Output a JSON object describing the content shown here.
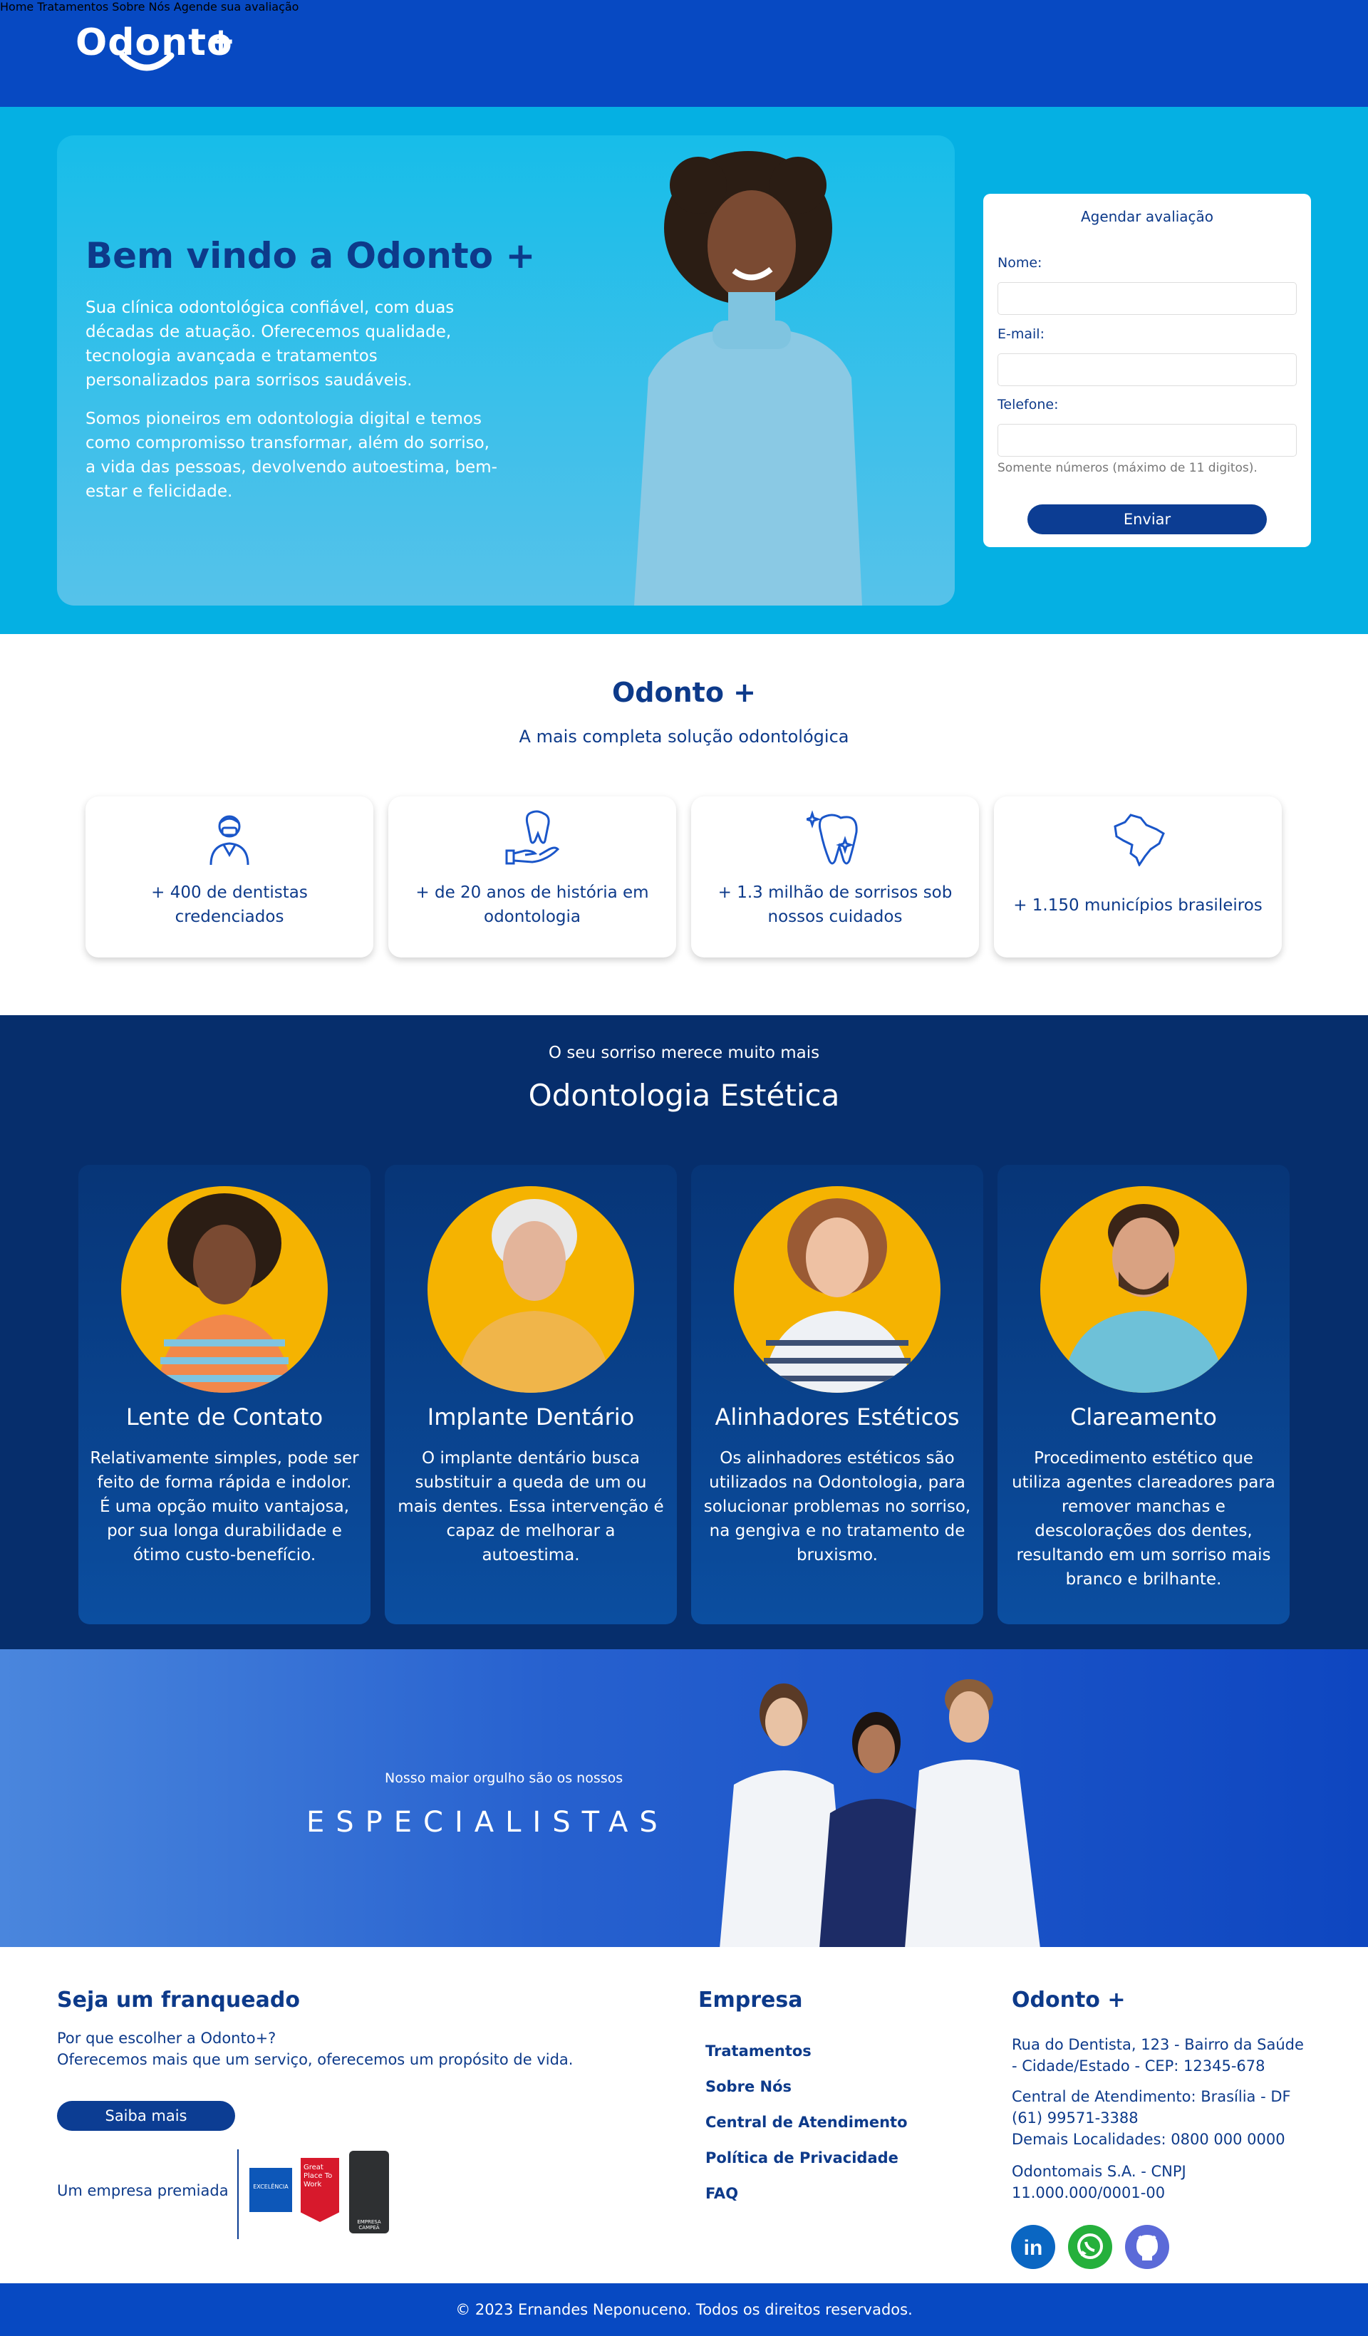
{
  "header": {
    "logo_text": "Odonto",
    "logo_plus": "+",
    "nav": [
      "Home",
      "Tratamentos",
      "Sobre Nós",
      "Agende sua avaliação"
    ]
  },
  "hero": {
    "title": "Bem vindo a Odonto +",
    "p1": "Sua clínica odontológica confiável, com duas décadas de atuação. Oferecemos qualidade, tecnologia avançada e tratamentos personalizados para sorrisos saudáveis.",
    "p2": "Somos pioneiros em odontologia digital e temos como compromisso transformar, além do sorriso, a vida das pessoas, devolvendo autoestima, bem-estar e felicidade."
  },
  "form": {
    "title": "Agendar avaliação",
    "name_label": "Nome:",
    "email_label": "E-mail:",
    "phone_label": "Telefone:",
    "phone_hint": "Somente números (máximo de 11 digitos).",
    "submit": "Enviar"
  },
  "about": {
    "title": "Odonto +",
    "subtitle": "A mais completa solução odontológica",
    "stats": [
      {
        "icon": "dentist-icon",
        "text": "+ 400 de dentistas credenciados"
      },
      {
        "icon": "tooth-hand-icon",
        "text": "+ de 20 anos de história em odontologia"
      },
      {
        "icon": "sparkling-tooth-icon",
        "text": "+ 1.3 milhão de sorrisos sob nossos cuidados"
      },
      {
        "icon": "brazil-map-icon",
        "text": "+ 1.150 municípios brasileiros"
      }
    ]
  },
  "esthetics": {
    "pretitle": "O seu sorriso merece muito mais",
    "title": "Odontologia Estética",
    "treatments": [
      {
        "title": "Lente de Contato",
        "text": "Relativamente simples, pode ser feito de forma rápida e indolor. É uma opção muito vantajosa, por sua longa durabilidade e ótimo custo-benefício."
      },
      {
        "title": "Implante Dentário",
        "text": "O implante dentário busca substituir a queda de um ou mais dentes. Essa intervenção é capaz de melhorar a autoestima."
      },
      {
        "title": "Alinhadores Estéticos",
        "text": "Os alinhadores estéticos são utilizados na Odontologia, para solucionar problemas no sorriso, na gengiva e no tratamento de bruxismo."
      },
      {
        "title": "Clareamento",
        "text": "Procedimento estético que utiliza agentes clareadores para remover manchas e descolorações dos dentes, resultando em um sorriso mais branco e brilhante."
      }
    ]
  },
  "specialists": {
    "pretitle": "Nosso maior orgulho são os nossos",
    "title": "ESPECIALISTAS"
  },
  "footer": {
    "franchise_title": "Seja um franqueado",
    "franchise_q": "Por que escolher a Odonto+?",
    "franchise_text": "Oferecemos mais que um serviço, oferecemos um propósito de vida.",
    "franchise_button": "Saiba mais",
    "award_label": "Um empresa premiada",
    "awards": [
      "EXCELÊNCIA",
      "Great Place To Work",
      "EMPRESA CAMPEÃ"
    ],
    "company_title": "Empresa",
    "company_links": [
      "Tratamentos",
      "Sobre Nós",
      "Central de Atendimento",
      "Política de Privacidade",
      "FAQ"
    ],
    "brand_title": "Odonto +",
    "address": "Rua do Dentista, 123 - Bairro da Saúde - Cidade/Estado - CEP: 12345-678",
    "phone1": "Central de Atendimento: Brasília - DF (61) 99571-3388",
    "phone2": "Demais Localidades: 0800 000 0000",
    "cnpj": "Odontomais S.A. - CNPJ 11.000.000/0001-00",
    "social": [
      "linkedin-icon",
      "whatsapp-icon",
      "github-icon"
    ]
  },
  "copyright": "© 2023 Ernandes Neponuceno. Todos os direitos reservados."
}
